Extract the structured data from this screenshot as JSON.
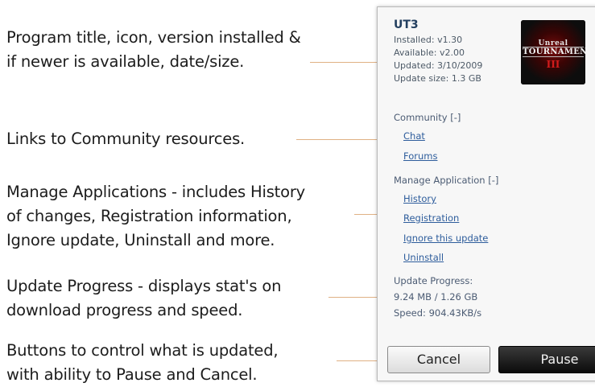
{
  "annotations": {
    "header": [
      "Program title, icon, version installed &",
      "if newer is available, date/size."
    ],
    "community": [
      "Links to Community resources."
    ],
    "manage": [
      "Manage Applications - includes History",
      "of changes, Registration information,",
      "Ignore update, Uninstall and more."
    ],
    "progress": [
      "Update Progress - displays stat's on",
      "download progress and speed."
    ],
    "buttons": [
      "Buttons to control what is updated,",
      "with ability to Pause and Cancel."
    ]
  },
  "panel": {
    "title": "UT3",
    "installed": "Installed:  v1.30",
    "available": "Available: v2.00",
    "updated": "Updated: 3/10/2009",
    "update_size": "Update size: 1.3 GB",
    "thumbnail": {
      "icon": "game-cover-thumbnail",
      "line1": "Unreal",
      "line2": "TOURNAMENT",
      "line3": "III"
    },
    "community": {
      "label": "Community [-]",
      "links": [
        "Chat",
        "Forums"
      ]
    },
    "manage": {
      "label": "Manage Application [-]",
      "links": [
        "History",
        "Registration",
        "Ignore this update",
        "Uninstall"
      ]
    },
    "progress": {
      "label": "Update Progress:",
      "amount": "9.24 MB / 1.26 GB",
      "speed": "Speed: 904.43KB/s"
    },
    "buttons": {
      "cancel": "Cancel",
      "pause": "Pause"
    }
  },
  "colors": {
    "leader": "#e0b184",
    "link": "#2e5d9c",
    "title": "#233f5f"
  }
}
